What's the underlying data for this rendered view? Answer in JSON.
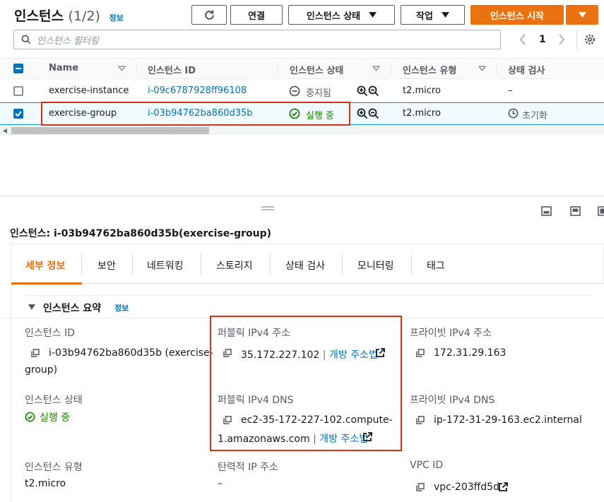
{
  "header": {
    "title": "인스턴스",
    "count": "(1/2)",
    "info": "정보",
    "connect_label": "연결",
    "state_label": "인스턴스 상태",
    "actions_label": "작업",
    "launch_label": "인스턴스 시작"
  },
  "search": {
    "placeholder": "인스턴스 필터링"
  },
  "pagination": {
    "page": "1"
  },
  "table": {
    "columns": [
      "Name",
      "인스턴스 ID",
      "인스턴스 상태",
      "인스턴스 유형",
      "상태 검사"
    ],
    "rows": [
      {
        "name": "exercise-instance",
        "id": "i-09c6787928ff96108",
        "state": "중지됨",
        "type": "t2.micro",
        "check": "–",
        "selected": false
      },
      {
        "name": "exercise-group",
        "id": "i-03b94762ba860d35b",
        "state": "실행 중",
        "type": "t2.micro",
        "check": "초기화",
        "selected": true
      }
    ]
  },
  "detail": {
    "heading": "인스턴스: i-03b94762ba860d35b(exercise-group)",
    "tabs": [
      "세부 정보",
      "보안",
      "네트워킹",
      "스토리지",
      "상태 검사",
      "모니터링",
      "태그"
    ],
    "summary_title": "인스턴스 요약",
    "summary_info": "정보",
    "fields": {
      "instance_id_label": "인스턴스 ID",
      "instance_id_value_1": "i-03b94762ba860d35b (exercise-",
      "instance_id_value_2": "group)",
      "public_ip_label": "퍼블릭 IPv4 주소",
      "public_ip_value": "35.172.227.102",
      "open_address": "개방 주소법",
      "private_ip_label": "프라이빗 IPv4 주소",
      "private_ip_value": "172.31.29.163",
      "state_label": "인스턴스 상태",
      "state_value": "실행 중",
      "public_dns_label": "퍼블릭 IPv4 DNS",
      "public_dns_value_1": "ec2-35-172-227-102.compute-",
      "public_dns_value_2": "1.amazonaws.com",
      "private_dns_label": "프라이빗 IPv4 DNS",
      "private_dns_value": "ip-172-31-29-163.ec2.internal",
      "type_label": "인스턴스 유형",
      "type_value": "t2.micro",
      "elastic_ip_label": "탄력적 IP 주소",
      "elastic_ip_value": "–",
      "vpc_label": "VPC ID",
      "vpc_value": "vpc-203ffd5d"
    }
  },
  "colors": {
    "accent": "#ec7211",
    "link": "#0073bb",
    "success": "#1d8102",
    "highlight": "#d13212"
  }
}
